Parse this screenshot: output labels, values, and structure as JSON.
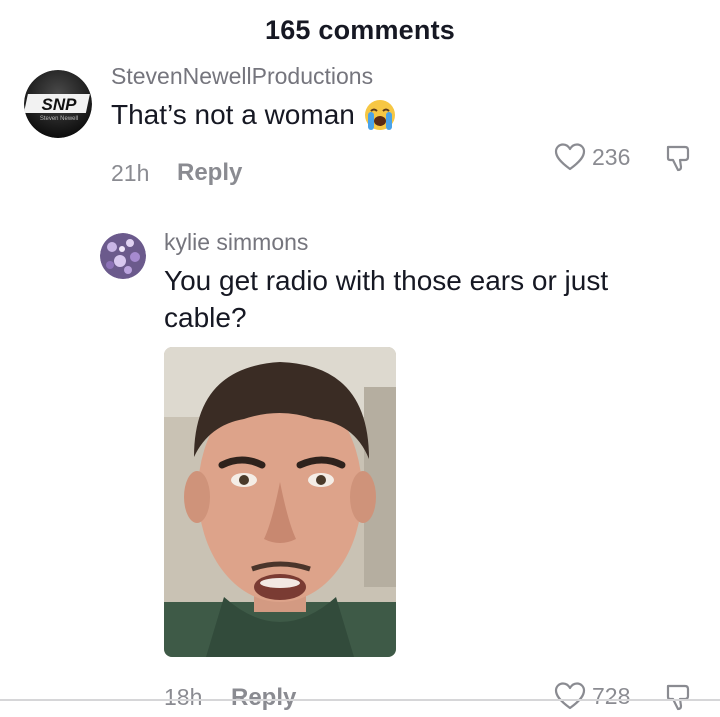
{
  "header": {
    "title": "165 comments"
  },
  "comments": [
    {
      "username": "StevenNewellProductions",
      "avatar_text": "SNP",
      "avatar_subtext": "Steven Newell",
      "text": "That’s not a woman",
      "emoji": "loudly-crying-face",
      "time": "21h",
      "reply_label": "Reply",
      "likes": "236"
    },
    {
      "username": "kylie simmons",
      "text_line1": "You get radio with those ears or just",
      "text_line2": "cable?",
      "has_photo": true,
      "time": "18h",
      "reply_label": "Reply",
      "likes": "728"
    }
  ],
  "colors": {
    "text": "#161823",
    "muted": "#8a8b91",
    "username": "#75757d"
  }
}
